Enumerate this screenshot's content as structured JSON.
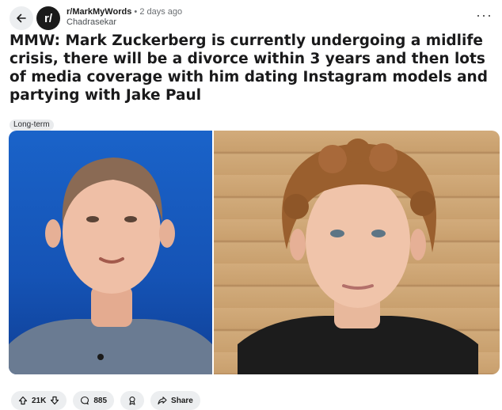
{
  "post": {
    "subreddit": "r/MarkMyWords",
    "separator": "•",
    "time": "2 days ago",
    "author": "Chadrasekar",
    "title": "MMW: Mark Zuckerberg is currently undergoing a midlife crisis, there will be a divorce within 3 years and then lots of media coverage with him dating Instagram models and partying with Jake Paul",
    "flair": "Long-term",
    "avatar_text": "r/"
  },
  "actions": {
    "votes": "21K",
    "comments": "885",
    "share_label": "Share"
  },
  "icons": {
    "back": "arrow-left-icon",
    "more": "more-horizontal-icon",
    "upvote": "upvote-arrow-icon",
    "downvote": "downvote-arrow-icon",
    "comment": "comment-bubble-icon",
    "award": "award-icon",
    "share": "share-arrow-icon"
  },
  "colors": {
    "pill_bg": "#eceef0",
    "left_photo_bg": "#1a63c9",
    "right_photo_bg": "#c9a06e"
  }
}
